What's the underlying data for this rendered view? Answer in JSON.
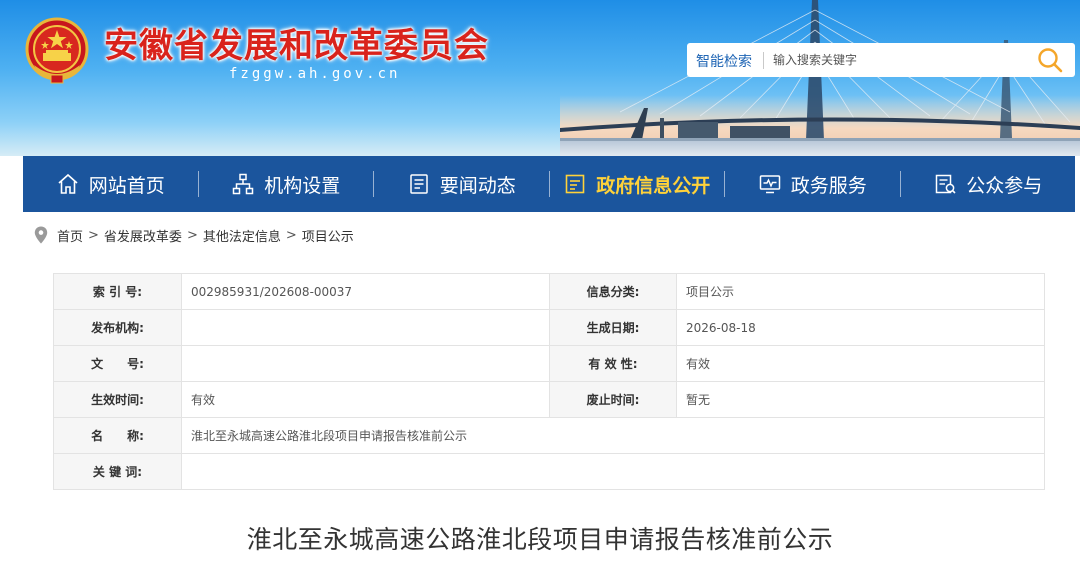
{
  "header": {
    "site_title": "安徽省发展和改革委员会",
    "site_domain": "fzggw.ah.gov.cn",
    "search": {
      "label": "智能检索",
      "placeholder": "输入搜索关键字"
    }
  },
  "nav": {
    "items": [
      {
        "label": "网站首页",
        "icon": "home-icon"
      },
      {
        "label": "机构设置",
        "icon": "org-chart-icon"
      },
      {
        "label": "要闻动态",
        "icon": "news-icon"
      },
      {
        "label": "政府信息公开",
        "icon": "info-disclosure-icon",
        "active": true
      },
      {
        "label": "政务服务",
        "icon": "monitor-icon"
      },
      {
        "label": "公众参与",
        "icon": "participation-icon"
      }
    ],
    "active_color": "#ffd23a",
    "bg_color": "#1b559d"
  },
  "breadcrumb": {
    "items": [
      "首页",
      "省发展改革委",
      "其他法定信息",
      "项目公示"
    ],
    "separator": ">"
  },
  "meta": {
    "index_no_label": "索 引 号:",
    "index_no": "002985931/202608-00037",
    "category_label": "信息分类:",
    "category": "项目公示",
    "publisher_label": "发布机构:",
    "publisher": "",
    "date_label": "生成日期:",
    "date": "2026-08-18",
    "doc_no_label": "文　　号:",
    "doc_no": "",
    "validity_label": "有 效 性:",
    "validity": "有效",
    "effective_label": "生效时间:",
    "effective": "有效",
    "expiry_label": "废止时间:",
    "expiry": "暂无",
    "name_label": "名　　称:",
    "name": "淮北至永城高速公路淮北段项目申请报告核准前公示",
    "keywords_label": "关 键 词:",
    "keywords": ""
  },
  "article": {
    "title": "淮北至永城高速公路淮北段项目申请报告核准前公示"
  },
  "colors": {
    "title_red": "#d9231c",
    "search_accent": "#f4a62a"
  }
}
